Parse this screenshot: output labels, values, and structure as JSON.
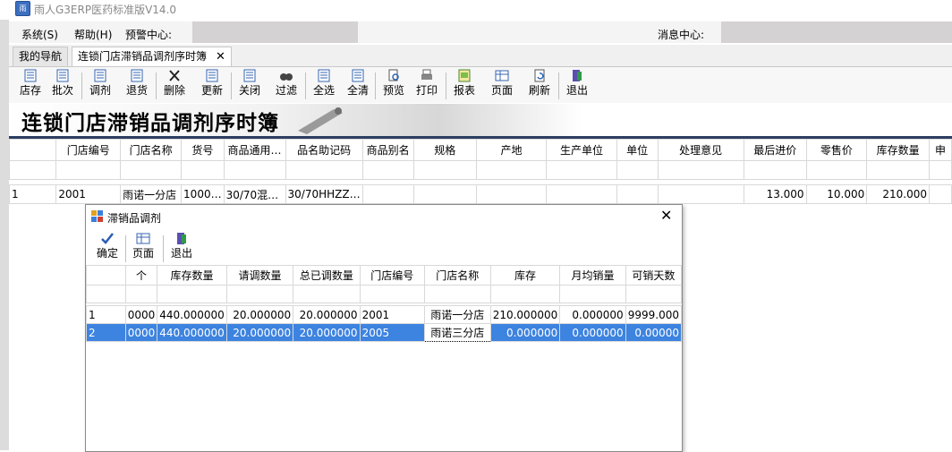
{
  "app": {
    "title": "雨人G3ERP医药标准版V14.0",
    "icon_label": "雨"
  },
  "menu": {
    "system": "系统(S)",
    "help": "帮助(H)",
    "alert_center": "预警中心:",
    "message_center": "消息中心:"
  },
  "tabs": [
    {
      "label": "我的导航"
    },
    {
      "label": "连锁门店滞销品调剂序时簿",
      "close": "✕"
    }
  ],
  "toolbar": {
    "items": [
      "店存",
      "批次",
      "调剂",
      "退货",
      "删除",
      "更新",
      "关闭",
      "过滤",
      "全选",
      "全清",
      "预览",
      "打印",
      "报表",
      "页面",
      "刷新",
      "退出"
    ]
  },
  "banner": {
    "title": "连锁门店滞销品调剂序时簿"
  },
  "main_grid": {
    "columns": [
      "门店编号",
      "门店名称",
      "货号",
      "商品通用…",
      "品名助记码",
      "商品别名",
      "规格",
      "产地",
      "生产单位",
      "单位",
      "处理意见",
      "最后进价",
      "零售价",
      "库存数量",
      "申"
    ],
    "rows": [
      [
        "1",
        "2001",
        "雨诺一分店",
        "1000…",
        "30/70混…",
        "30/70HHZZ…",
        "",
        "",
        "",
        "",
        "",
        "",
        "13.000",
        "10.000",
        "210.000",
        ""
      ]
    ]
  },
  "dialog": {
    "title": "滞销品调剂",
    "close": "✕",
    "toolbar": [
      "确定",
      "页面",
      "退出"
    ],
    "columns": [
      "个",
      "库存数量",
      "请调数量",
      "总已调数量",
      "门店编号",
      "门店名称",
      "库存",
      "月均销量",
      "可销天数"
    ],
    "rows": [
      [
        "1",
        "0000",
        "440.000000",
        "20.000000",
        "20.000000",
        "2001",
        "雨诺一分店",
        "210.000000",
        "0.000000",
        "9999.000"
      ],
      [
        "2",
        "0000",
        "440.000000",
        "20.000000",
        "20.000000",
        "2005",
        "雨诺三分店",
        "0.000000",
        "0.000000",
        "0.00000"
      ]
    ]
  },
  "colors": {
    "selection": "#3d83e0",
    "banner_line": "#2c3e62",
    "gray_block": "#d4d2d2"
  }
}
